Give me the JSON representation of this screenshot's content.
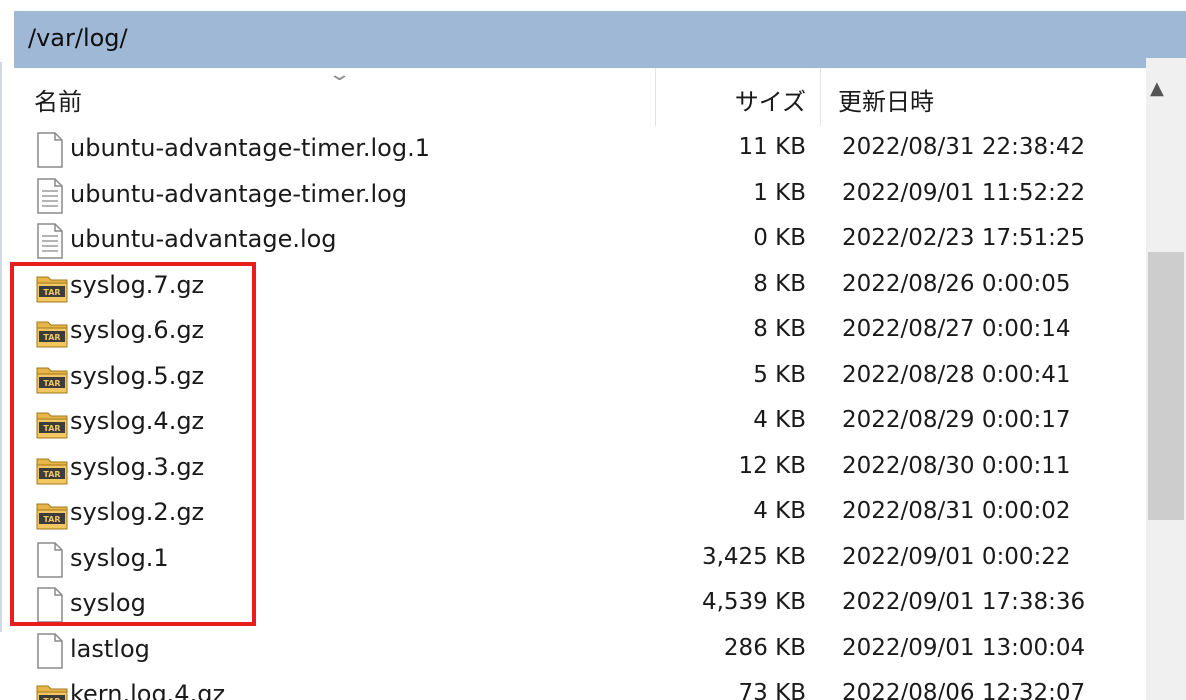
{
  "path": "/var/log/",
  "columns": {
    "name": "名前",
    "size": "サイズ",
    "modified": "更新日時"
  },
  "files": [
    {
      "name": "ubuntu-advantage-timer.log.1",
      "size": "11 KB",
      "modified": "2022/08/31 22:38:42",
      "icon": "file-icon"
    },
    {
      "name": "ubuntu-advantage-timer.log",
      "size": "1 KB",
      "modified": "2022/09/01 11:52:22",
      "icon": "text-file-icon"
    },
    {
      "name": "ubuntu-advantage.log",
      "size": "0 KB",
      "modified": "2022/02/23 17:51:25",
      "icon": "text-file-icon"
    },
    {
      "name": "syslog.7.gz",
      "size": "8 KB",
      "modified": "2022/08/26 0:00:05",
      "icon": "archive-icon"
    },
    {
      "name": "syslog.6.gz",
      "size": "8 KB",
      "modified": "2022/08/27 0:00:14",
      "icon": "archive-icon"
    },
    {
      "name": "syslog.5.gz",
      "size": "5 KB",
      "modified": "2022/08/28 0:00:41",
      "icon": "archive-icon"
    },
    {
      "name": "syslog.4.gz",
      "size": "4 KB",
      "modified": "2022/08/29 0:00:17",
      "icon": "archive-icon"
    },
    {
      "name": "syslog.3.gz",
      "size": "12 KB",
      "modified": "2022/08/30 0:00:11",
      "icon": "archive-icon"
    },
    {
      "name": "syslog.2.gz",
      "size": "4 KB",
      "modified": "2022/08/31 0:00:02",
      "icon": "archive-icon"
    },
    {
      "name": "syslog.1",
      "size": "3,425 KB",
      "modified": "2022/09/01 0:00:22",
      "icon": "file-icon"
    },
    {
      "name": "syslog",
      "size": "4,539 KB",
      "modified": "2022/09/01 17:38:36",
      "icon": "file-icon"
    },
    {
      "name": "lastlog",
      "size": "286 KB",
      "modified": "2022/09/01 13:00:04",
      "icon": "file-icon"
    },
    {
      "name": "kern.log.4.gz",
      "size": "73 KB",
      "modified": "2022/08/06 12:32:07",
      "icon": "archive-icon"
    }
  ],
  "colors": {
    "path_bar": "#9fb8d6",
    "highlight_box": "#ea1c1c"
  }
}
